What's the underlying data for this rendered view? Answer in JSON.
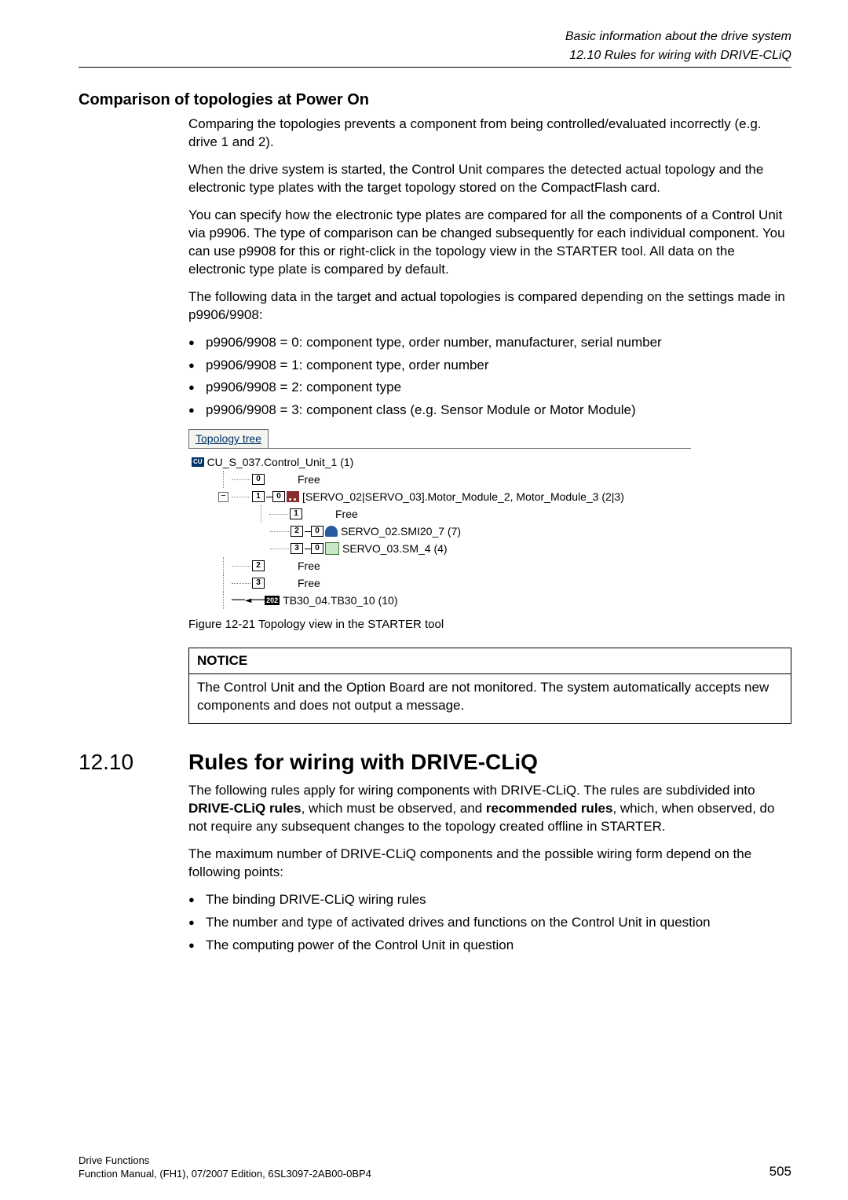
{
  "header": {
    "running_title": "Basic information about the drive system",
    "running_sub": "12.10 Rules for wiring with DRIVE-CLiQ"
  },
  "section_compare": {
    "heading": "Comparison of topologies at Power On",
    "p1": "Comparing the topologies prevents a component from being controlled/evaluated incorrectly (e.g. drive 1 and 2).",
    "p2": "When the drive system is started, the Control Unit compares the detected actual topology and the electronic type plates with the target topology stored on the CompactFlash card.",
    "p3": "You can specify how the electronic type plates are compared for all the components of a Control Unit via p9906. The type of comparison can be changed subsequently for each individual component. You can use p9908 for this or right-click in the topology view in the STARTER tool. All data on the electronic type plate is compared by default.",
    "p4": "The following data in the target and actual topologies is compared depending on the settings made in p9906/9908:",
    "bullets": [
      "p9906/9908 = 0: component type, order number, manufacturer, serial number",
      "p9906/9908 = 1: component type, order number",
      "p9906/9908 = 2: component type",
      "p9906/9908 = 3: component class (e.g. Sensor Module or Motor Module)"
    ]
  },
  "topology": {
    "tab_label": "Topology tree",
    "root": "CU_S_037.Control_Unit_1 (1)",
    "port0": "0",
    "free": "Free",
    "port1": "1",
    "mm_line_port": "1",
    "mm_line_second": "0",
    "mm_text": "[SERVO_02|SERVO_03].Motor_Module_2, Motor_Module_3 (2|3)",
    "mm_child_port1": "1",
    "mm_child_port2": "2",
    "mm_child_port2b": "0",
    "smi_text": "SERVO_02.SMI20_7 (7)",
    "mm_child_port3": "3",
    "mm_child_port3b": "0",
    "sm4_text": "SERVO_03.SM_4 (4)",
    "port2": "2",
    "port3": "3",
    "tb_arrow": "──◄──",
    "tb_badge": "202",
    "tb_text": "TB30_04.TB30_10 (10)"
  },
  "figure_caption": "Figure 12-21   Topology view in the STARTER tool",
  "notice": {
    "title": "NOTICE",
    "body": "The Control Unit and the Option Board are not monitored. The system automatically accepts new components and does not output a message."
  },
  "section1210": {
    "number": "12.10",
    "title": "Rules for wiring with DRIVE-CLiQ",
    "p1_pre": "The following rules apply for wiring components with DRIVE-CLiQ. The rules are subdivided into ",
    "p1_b1": "DRIVE-CLiQ rules",
    "p1_mid": ", which must be observed, and ",
    "p1_b2": "recommended rules",
    "p1_post": ", which, when observed, do not require any subsequent changes to the topology created offline in STARTER.",
    "p2": "The maximum number of DRIVE-CLiQ components and the possible wiring form depend on the following points:",
    "bullets": [
      "The binding DRIVE-CLiQ wiring rules",
      "The number and type of activated drives and functions on the Control Unit in question",
      "The computing power of the Control Unit in question"
    ]
  },
  "footer": {
    "left1": "Drive Functions",
    "left2": "Function Manual, (FH1), 07/2007 Edition, 6SL3097-2AB00-0BP4",
    "right": "505"
  }
}
